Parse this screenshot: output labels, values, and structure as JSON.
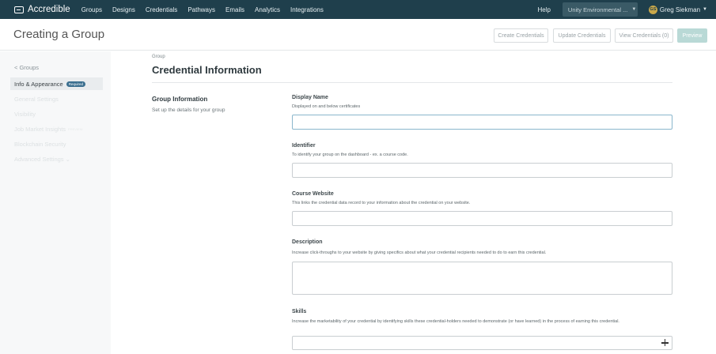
{
  "app": {
    "name": "Accredible"
  },
  "nav": {
    "items": [
      "Groups",
      "Designs",
      "Credentials",
      "Pathways",
      "Emails",
      "Analytics",
      "Integrations"
    ],
    "help": "Help",
    "org_select": "Unity Environmental ...",
    "user_name": "Greg Siekman",
    "user_initials": "GS"
  },
  "header": {
    "title": "Creating a Group",
    "create_credentials": "Create Credentials",
    "update_credentials": "Update Credentials",
    "view_credentials": "View Credentials (0)",
    "preview": "Preview"
  },
  "sidebar": {
    "back": "< Groups",
    "items": [
      {
        "label": "Info & Appearance",
        "badge": "Required"
      },
      {
        "label": "General Settings"
      },
      {
        "label": "Visibility"
      },
      {
        "label": "Job Market Insights",
        "beta": "PREVIEW"
      },
      {
        "label": "Blockchain Security"
      },
      {
        "label": "Advanced Settings ⌄"
      }
    ]
  },
  "main": {
    "breadcrumb": "Group",
    "title": "Credential Information",
    "group_info_heading": "Group Information",
    "group_info_desc": "Set up the details for your group"
  },
  "fields": {
    "display_name": {
      "label": "Display Name",
      "help": "Displayed on and below certificates",
      "value": ""
    },
    "identifier": {
      "label": "Identifier",
      "help": "To identify your group on the dashboard - ex. a course code.",
      "value": ""
    },
    "course_website": {
      "label": "Course Website",
      "help": "This links the credential data record to your information about the credential on your website.",
      "value": ""
    },
    "description": {
      "label": "Description",
      "help": "Increase click-throughs to your website by giving specifics about what your credential recipients needed to do to earn this credential.",
      "value": ""
    },
    "skills": {
      "label": "Skills",
      "help": "Increase the marketability of your credential by identifying skills these credential-holders needed to demonstrate (or have learned) in the process of earning this credential.",
      "value": ""
    }
  },
  "icons": {
    "logo": "accredible-logo-icon",
    "add_skill": "plus-icon"
  }
}
